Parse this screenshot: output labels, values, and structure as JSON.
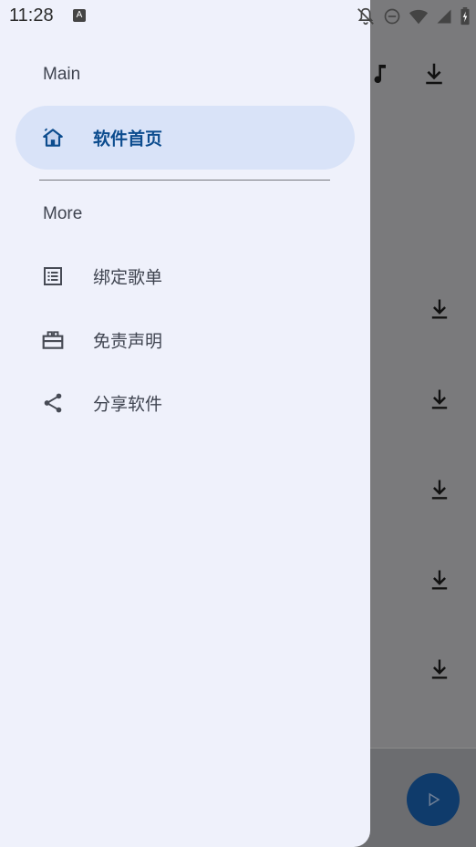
{
  "status": {
    "time": "11:28",
    "badge": "A"
  },
  "drawer": {
    "sections": [
      {
        "title": "Main"
      },
      {
        "title": "More"
      }
    ],
    "items": [
      {
        "label": "软件首页",
        "icon": "home-icon",
        "active": true
      },
      {
        "label": "绑定歌单",
        "icon": "list-icon",
        "active": false
      },
      {
        "label": "免责声明",
        "icon": "gift-icon",
        "active": false
      },
      {
        "label": "分享软件",
        "icon": "share-icon",
        "active": false
      }
    ]
  },
  "colors": {
    "drawer_bg": "#eff1fb",
    "active_bg": "#d9e3f8",
    "active_text": "#0c4c8e",
    "text": "#3f4450",
    "fab": "#0f3b6b"
  }
}
